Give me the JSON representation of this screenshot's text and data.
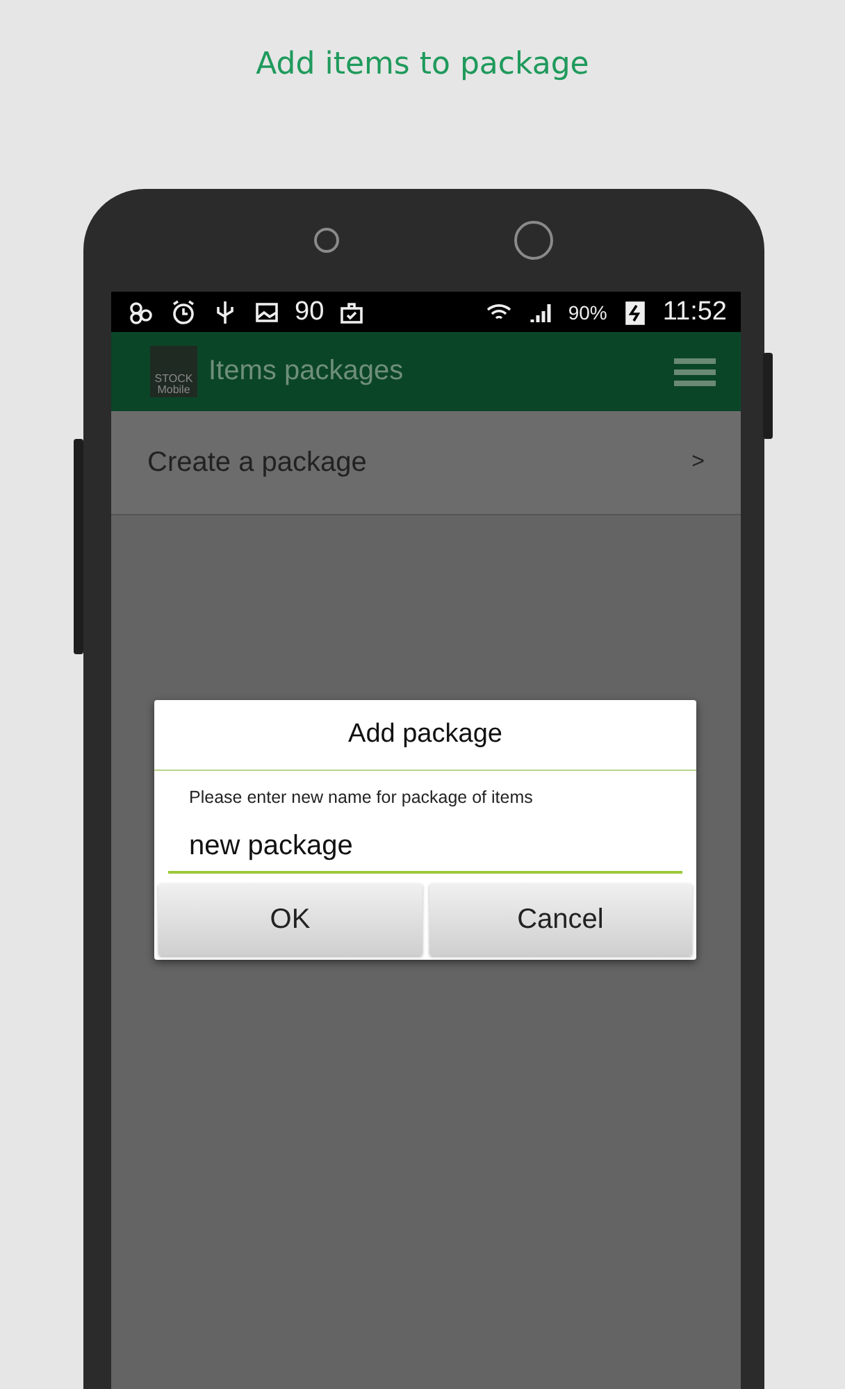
{
  "heading": "Add items to package",
  "status_bar": {
    "left_text": "90",
    "battery": "90%",
    "time": "11:52"
  },
  "app_bar": {
    "logo_lines": [
      "STOCK",
      "Mobile"
    ],
    "title": "Items packages"
  },
  "list": [
    {
      "label": "Create a package",
      "chevron": ">"
    }
  ],
  "dialog": {
    "title": "Add package",
    "prompt": "Please enter new name for package of items",
    "value": "new package",
    "buttons": [
      "OK",
      "Cancel"
    ]
  }
}
